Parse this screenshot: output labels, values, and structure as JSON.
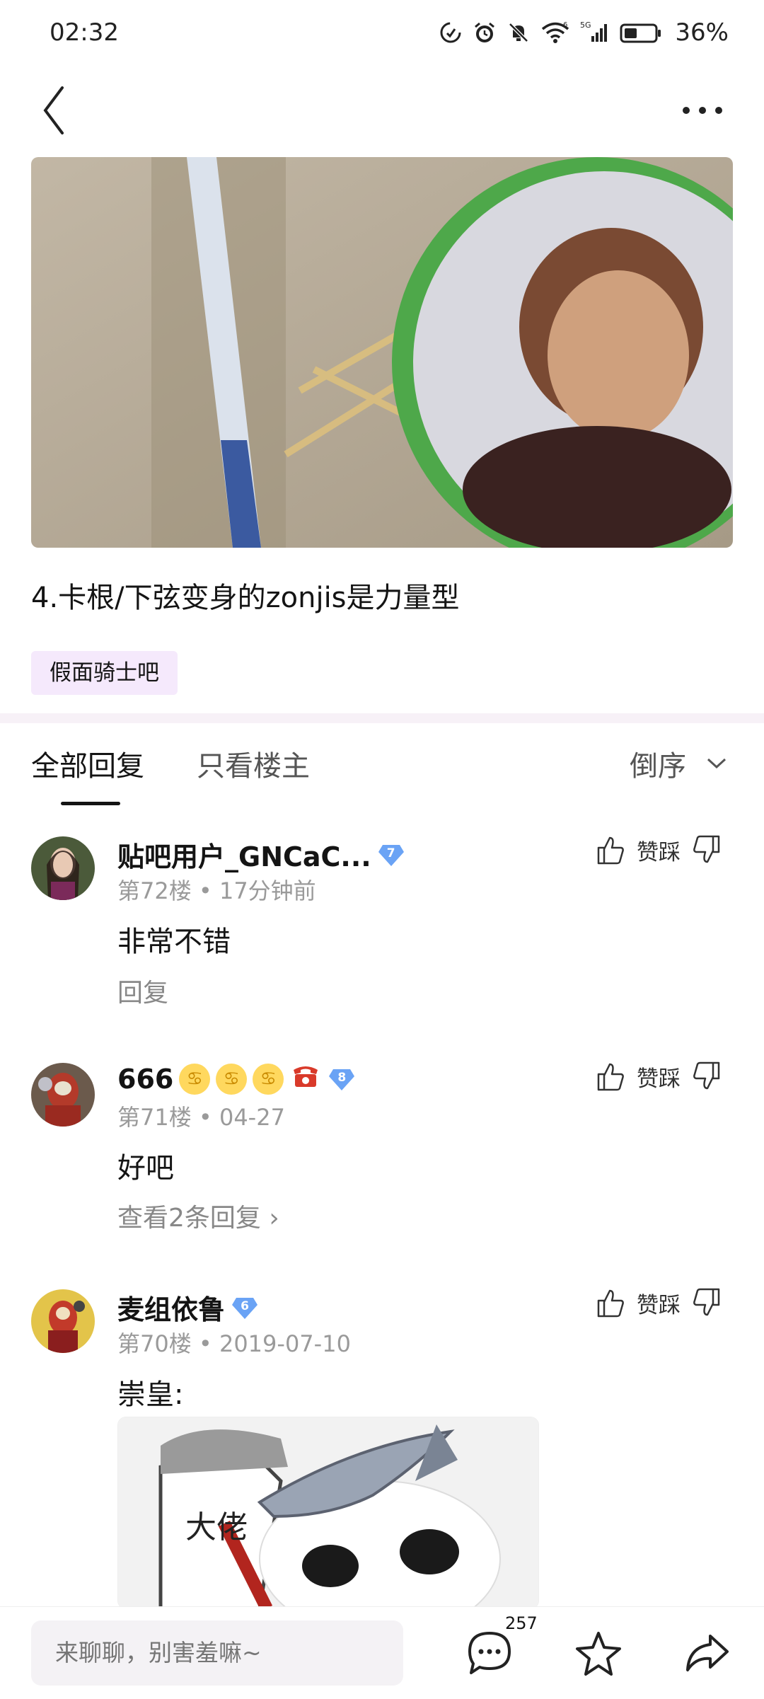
{
  "status_bar": {
    "time": "02:32",
    "battery": "36%",
    "icons": [
      "data-saver-icon",
      "alarm-icon",
      "mute-icon",
      "wifi-icon",
      "signal-5g-icon",
      "battery-icon"
    ]
  },
  "nav": {
    "back_icon": "chevron-left-icon",
    "more_icon": "more-dots-icon"
  },
  "post": {
    "text": "4.卡根/下弦变身的zonjis是力量型",
    "forum_tag": "假面骑士吧"
  },
  "tabs": {
    "all": "全部回复",
    "owner_only": "只看楼主",
    "sort": "倒序"
  },
  "replies": [
    {
      "username": "贴吧用户_GNCaC...",
      "level": "7",
      "floor": "第72楼",
      "time": "17分钟前",
      "content": "非常不错",
      "action": "回复",
      "vote_label": "赞踩"
    },
    {
      "username": "666",
      "level": "8",
      "floor": "第71楼",
      "time": "04-27",
      "content": "好吧",
      "action": "查看2条回复 ›",
      "vote_label": "赞踩"
    },
    {
      "username": "麦组依鲁",
      "level": "6",
      "floor": "第70楼",
      "time": "2019-07-10",
      "content": "崇皇:",
      "image_text": "大佬",
      "vote_label": "赞踩"
    }
  ],
  "bottom_bar": {
    "input_placeholder": "来聊聊，别害羞嘛~",
    "comment_count": "257"
  },
  "colors": {
    "tag_bg": "#f5e9fc",
    "badge_blue": "#6aa3f5",
    "meta_gray": "#9a9a9a"
  }
}
